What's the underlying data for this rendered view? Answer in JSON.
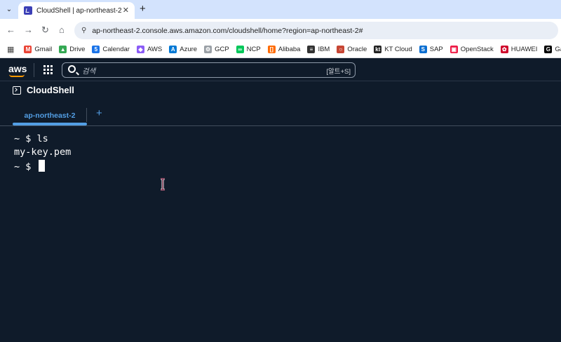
{
  "browser": {
    "tab_title": "CloudShell | ap-northeast-2",
    "new_tab": "+",
    "url": "ap-northeast-2.console.aws.amazon.com/cloudshell/home?region=ap-northeast-2#"
  },
  "bookmarks": [
    {
      "label": "Gmail",
      "color": "#ea4335",
      "glyph": "M"
    },
    {
      "label": "Drive",
      "color": "#34a853",
      "glyph": "▲"
    },
    {
      "label": "Calendar",
      "color": "#1a73e8",
      "glyph": "5"
    },
    {
      "label": "AWS",
      "color": "#8b5cf6",
      "glyph": "◆"
    },
    {
      "label": "Azure",
      "color": "#0078d4",
      "glyph": "A"
    },
    {
      "label": "GCP",
      "color": "#9aa0a6",
      "glyph": "⚙"
    },
    {
      "label": "NCP",
      "color": "#03c75a",
      "glyph": "∞"
    },
    {
      "label": "Alibaba",
      "color": "#ff6a00",
      "glyph": "[]"
    },
    {
      "label": "IBM",
      "color": "#333333",
      "glyph": "≡"
    },
    {
      "label": "Oracle",
      "color": "#c74634",
      "glyph": "○"
    },
    {
      "label": "KT Cloud",
      "color": "#222222",
      "glyph": "kt"
    },
    {
      "label": "SAP",
      "color": "#0a6ed1",
      "glyph": "S"
    },
    {
      "label": "OpenStack",
      "color": "#ed1944",
      "glyph": "▣"
    },
    {
      "label": "HUAWEI",
      "color": "#cf0a2c",
      "glyph": "✿"
    },
    {
      "label": "Gabia",
      "color": "#000000",
      "glyph": "G"
    }
  ],
  "aws": {
    "logo": "aws",
    "search_placeholder": "검색",
    "search_shortcut": "[알트+S]"
  },
  "cloudshell": {
    "title": "CloudShell",
    "tab_label": "ap-northeast-2",
    "add_tab": "+"
  },
  "terminal": {
    "lines": [
      "~ $ ls",
      "my-key.pem",
      "~ $ "
    ]
  },
  "colors": {
    "console_bg": "#0f1b2a",
    "accent_blue": "#539fe5",
    "aws_orange": "#ff9900"
  }
}
